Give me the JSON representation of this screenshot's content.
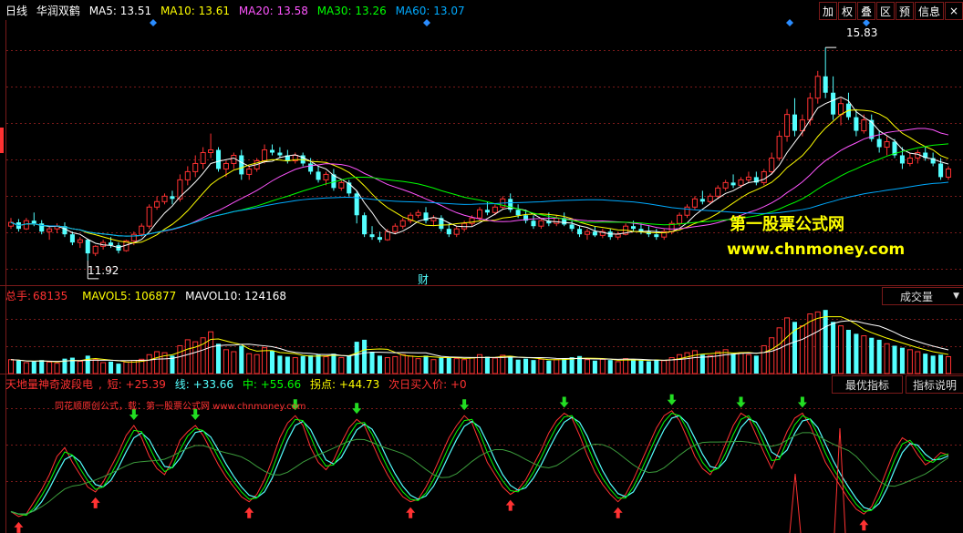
{
  "main": {
    "period": "日线",
    "stock": "华润双鹤",
    "ma": [
      {
        "label": "MA5: 13.51",
        "color": "#ffffff"
      },
      {
        "label": "MA10: 13.61",
        "color": "#ffff00"
      },
      {
        "label": "MA20: 13.58",
        "color": "#ff55ff"
      },
      {
        "label": "MA30: 13.26",
        "color": "#00ff00"
      },
      {
        "label": "MA60: 13.07",
        "color": "#00aaff"
      }
    ],
    "toolbar": [
      "加",
      "叠",
      "区",
      "权",
      "预",
      "信息"
    ],
    "high_label": "15.83",
    "low_label": "11.92",
    "cai_label": "财",
    "watermark1": "第一股票公式网",
    "watermark2": "www.chnmoney.com"
  },
  "vol": {
    "total_label": "总手:",
    "total_value": "68135",
    "mavol5": "MAVOL5: 106877",
    "mavol10": "MAVOL10: 124168",
    "dropdown": "成交量"
  },
  "ind": {
    "name": "天地量神奇波段电",
    "short": "短: +25.39",
    "line": "线: +33.66",
    "mid": "中: +55.66",
    "turn": "拐点: +44.73",
    "next": "次日买入价: +0",
    "btn_best": "最优指标",
    "btn_help": "指标说明",
    "note": "同花顺原创公式，载：第一股票公式网 www.chnmoney.com"
  },
  "colors": {
    "up": "#ff3232",
    "down": "#54ffff",
    "grid": "#7a1a1a"
  },
  "chart_data": {
    "type": "candlestick",
    "candles": [
      [
        12.55,
        12.7,
        12.5,
        12.62
      ],
      [
        12.62,
        12.68,
        12.45,
        12.5
      ],
      [
        12.5,
        12.7,
        12.48,
        12.65
      ],
      [
        12.65,
        12.8,
        12.55,
        12.6
      ],
      [
        12.6,
        12.66,
        12.4,
        12.45
      ],
      [
        12.45,
        12.55,
        12.3,
        12.5
      ],
      [
        12.5,
        12.6,
        12.42,
        12.55
      ],
      [
        12.55,
        12.62,
        12.35,
        12.4
      ],
      [
        12.4,
        12.45,
        12.2,
        12.25
      ],
      [
        12.25,
        12.35,
        12.15,
        12.3
      ],
      [
        12.3,
        12.32,
        11.92,
        12.05
      ],
      [
        12.05,
        12.2,
        12.0,
        12.18
      ],
      [
        12.18,
        12.3,
        12.12,
        12.25
      ],
      [
        12.25,
        12.35,
        12.15,
        12.2
      ],
      [
        12.2,
        12.25,
        12.05,
        12.1
      ],
      [
        12.1,
        12.3,
        12.08,
        12.28
      ],
      [
        12.28,
        12.45,
        12.2,
        12.4
      ],
      [
        12.4,
        12.6,
        12.35,
        12.55
      ],
      [
        12.55,
        12.95,
        12.5,
        12.9
      ],
      [
        12.9,
        13.1,
        12.85,
        13.0
      ],
      [
        13.0,
        13.15,
        12.95,
        13.1
      ],
      [
        13.1,
        13.2,
        12.95,
        13.05
      ],
      [
        13.05,
        13.5,
        13.0,
        13.4
      ],
      [
        13.4,
        13.65,
        13.3,
        13.55
      ],
      [
        13.55,
        13.85,
        13.45,
        13.7
      ],
      [
        13.7,
        14.0,
        13.6,
        13.9
      ],
      [
        13.9,
        14.25,
        13.8,
        13.95
      ],
      [
        13.95,
        14.0,
        13.55,
        13.6
      ],
      [
        13.6,
        13.75,
        13.45,
        13.7
      ],
      [
        13.7,
        13.9,
        13.6,
        13.85
      ],
      [
        13.85,
        13.95,
        13.4,
        13.5
      ],
      [
        13.5,
        13.65,
        13.4,
        13.6
      ],
      [
        13.6,
        13.8,
        13.55,
        13.75
      ],
      [
        13.75,
        14.05,
        13.7,
        13.95
      ],
      [
        13.95,
        14.05,
        13.85,
        13.9
      ],
      [
        13.9,
        14.0,
        13.8,
        13.85
      ],
      [
        13.85,
        13.95,
        13.7,
        13.75
      ],
      [
        13.75,
        13.9,
        13.7,
        13.85
      ],
      [
        13.85,
        13.9,
        13.65,
        13.7
      ],
      [
        13.7,
        13.8,
        13.5,
        13.55
      ],
      [
        13.55,
        13.65,
        13.35,
        13.4
      ],
      [
        13.4,
        13.55,
        13.3,
        13.5
      ],
      [
        13.5,
        13.6,
        13.2,
        13.25
      ],
      [
        13.25,
        13.4,
        13.2,
        13.35
      ],
      [
        13.35,
        13.4,
        13.1,
        13.15
      ],
      [
        13.15,
        13.2,
        12.6,
        12.75
      ],
      [
        12.75,
        12.8,
        12.35,
        12.4
      ],
      [
        12.4,
        12.55,
        12.3,
        12.35
      ],
      [
        12.35,
        12.45,
        12.25,
        12.3
      ],
      [
        12.3,
        12.5,
        12.28,
        12.45
      ],
      [
        12.45,
        12.6,
        12.4,
        12.55
      ],
      [
        12.55,
        12.7,
        12.5,
        12.65
      ],
      [
        12.65,
        12.8,
        12.6,
        12.75
      ],
      [
        12.75,
        12.85,
        12.7,
        12.8
      ],
      [
        12.8,
        12.9,
        12.6,
        12.65
      ],
      [
        12.65,
        12.75,
        12.55,
        12.7
      ],
      [
        12.7,
        12.75,
        12.45,
        12.5
      ],
      [
        12.5,
        12.6,
        12.35,
        12.4
      ],
      [
        12.4,
        12.55,
        12.35,
        12.5
      ],
      [
        12.5,
        12.65,
        12.45,
        12.6
      ],
      [
        12.6,
        12.75,
        12.55,
        12.7
      ],
      [
        12.7,
        12.9,
        12.65,
        12.85
      ],
      [
        12.85,
        13.0,
        12.75,
        12.8
      ],
      [
        12.8,
        12.95,
        12.75,
        12.9
      ],
      [
        12.9,
        13.1,
        12.85,
        13.05
      ],
      [
        13.05,
        13.15,
        12.8,
        12.85
      ],
      [
        12.85,
        12.95,
        12.7,
        12.75
      ],
      [
        12.75,
        12.85,
        12.6,
        12.65
      ],
      [
        12.65,
        12.75,
        12.5,
        12.55
      ],
      [
        12.55,
        12.7,
        12.5,
        12.65
      ],
      [
        12.65,
        12.8,
        12.55,
        12.6
      ],
      [
        12.6,
        12.75,
        12.55,
        12.7
      ],
      [
        12.7,
        12.8,
        12.55,
        12.58
      ],
      [
        12.58,
        12.65,
        12.45,
        12.5
      ],
      [
        12.5,
        12.55,
        12.35,
        12.4
      ],
      [
        12.4,
        12.5,
        12.3,
        12.45
      ],
      [
        12.45,
        12.55,
        12.35,
        12.38
      ],
      [
        12.38,
        12.5,
        12.33,
        12.45
      ],
      [
        12.45,
        12.5,
        12.3,
        12.35
      ],
      [
        12.35,
        12.45,
        12.3,
        12.4
      ],
      [
        12.4,
        12.6,
        12.38,
        12.55
      ],
      [
        12.55,
        12.65,
        12.45,
        12.5
      ],
      [
        12.5,
        12.6,
        12.4,
        12.45
      ],
      [
        12.45,
        12.55,
        12.35,
        12.4
      ],
      [
        12.4,
        12.5,
        12.3,
        12.35
      ],
      [
        12.35,
        12.5,
        12.3,
        12.45
      ],
      [
        12.45,
        12.65,
        12.4,
        12.6
      ],
      [
        12.6,
        12.8,
        12.55,
        12.75
      ],
      [
        12.75,
        12.95,
        12.7,
        12.9
      ],
      [
        12.9,
        13.1,
        12.85,
        13.05
      ],
      [
        13.05,
        13.2,
        12.95,
        13.0
      ],
      [
        13.0,
        13.15,
        12.95,
        13.1
      ],
      [
        13.1,
        13.3,
        13.05,
        13.25
      ],
      [
        13.25,
        13.4,
        13.2,
        13.35
      ],
      [
        13.35,
        13.5,
        13.25,
        13.3
      ],
      [
        13.3,
        13.45,
        13.25,
        13.4
      ],
      [
        13.4,
        13.55,
        13.35,
        13.45
      ],
      [
        13.45,
        13.55,
        13.3,
        13.35
      ],
      [
        13.35,
        13.6,
        13.3,
        13.55
      ],
      [
        13.55,
        13.9,
        13.5,
        13.8
      ],
      [
        13.8,
        14.3,
        13.75,
        14.2
      ],
      [
        14.2,
        14.7,
        14.1,
        14.6
      ],
      [
        14.6,
        14.9,
        14.2,
        14.3
      ],
      [
        14.3,
        14.6,
        14.2,
        14.5
      ],
      [
        14.5,
        15.0,
        14.4,
        14.9
      ],
      [
        14.9,
        15.4,
        14.8,
        15.3
      ],
      [
        15.3,
        15.83,
        14.9,
        15.0
      ],
      [
        15.0,
        15.3,
        14.5,
        14.6
      ],
      [
        14.6,
        14.9,
        14.4,
        14.8
      ],
      [
        14.8,
        15.0,
        14.5,
        14.55
      ],
      [
        14.55,
        14.7,
        14.2,
        14.3
      ],
      [
        14.3,
        14.6,
        14.25,
        14.5
      ],
      [
        14.5,
        14.6,
        14.1,
        14.15
      ],
      [
        14.15,
        14.3,
        13.9,
        14.0
      ],
      [
        14.0,
        14.2,
        13.85,
        14.1
      ],
      [
        14.1,
        14.15,
        13.8,
        13.85
      ],
      [
        13.85,
        14.0,
        13.6,
        13.7
      ],
      [
        13.7,
        13.9,
        13.65,
        13.8
      ],
      [
        13.8,
        13.95,
        13.7,
        13.9
      ],
      [
        13.9,
        14.0,
        13.75,
        13.8
      ],
      [
        13.8,
        13.9,
        13.65,
        13.7
      ],
      [
        13.7,
        13.8,
        13.4,
        13.45
      ],
      [
        13.45,
        13.65,
        13.4,
        13.6
      ]
    ],
    "volume": [
      70,
      65,
      55,
      60,
      68,
      58,
      52,
      75,
      80,
      62,
      90,
      70,
      55,
      60,
      50,
      58,
      66,
      72,
      95,
      110,
      105,
      90,
      140,
      170,
      160,
      180,
      210,
      150,
      120,
      110,
      140,
      100,
      95,
      130,
      115,
      90,
      85,
      80,
      88,
      92,
      95,
      85,
      100,
      80,
      90,
      160,
      170,
      110,
      90,
      80,
      85,
      95,
      88,
      75,
      90,
      70,
      80,
      85,
      75,
      70,
      80,
      95,
      85,
      78,
      92,
      88,
      70,
      75,
      68,
      72,
      65,
      70,
      78,
      82,
      88,
      70,
      65,
      72,
      68,
      60,
      75,
      70,
      66,
      62,
      70,
      65,
      80,
      95,
      105,
      115,
      95,
      90,
      110,
      120,
      100,
      105,
      95,
      90,
      140,
      180,
      230,
      280,
      260,
      240,
      300,
      310,
      320,
      260,
      240,
      220,
      200,
      190,
      180,
      170,
      150,
      140,
      130,
      120,
      110,
      100,
      90,
      95,
      85
    ],
    "indicator": {
      "short": [
        10,
        6,
        8,
        18,
        28,
        40,
        55,
        62,
        50,
        40,
        30,
        26,
        34,
        46,
        58,
        72,
        80,
        70,
        55,
        45,
        40,
        52,
        68,
        75,
        80,
        72,
        60,
        48,
        38,
        30,
        22,
        18,
        24,
        36,
        52,
        70,
        82,
        88,
        80,
        62,
        50,
        44,
        52,
        66,
        78,
        85,
        80,
        66,
        52,
        40,
        30,
        22,
        18,
        20,
        30,
        42,
        56,
        70,
        80,
        88,
        82,
        66,
        50,
        40,
        30,
        24,
        28,
        36,
        48,
        60,
        74,
        84,
        90,
        86,
        72,
        56,
        42,
        32,
        24,
        18,
        24,
        36,
        50,
        64,
        78,
        88,
        92,
        84,
        70,
        55,
        45,
        40,
        50,
        65,
        80,
        90,
        86,
        72,
        58,
        45,
        60,
        75,
        86,
        90,
        80,
        65,
        50,
        40,
        30,
        20,
        12,
        8,
        14,
        28,
        44,
        60,
        70,
        66,
        56,
        48,
        52,
        58,
        56
      ]
    }
  }
}
